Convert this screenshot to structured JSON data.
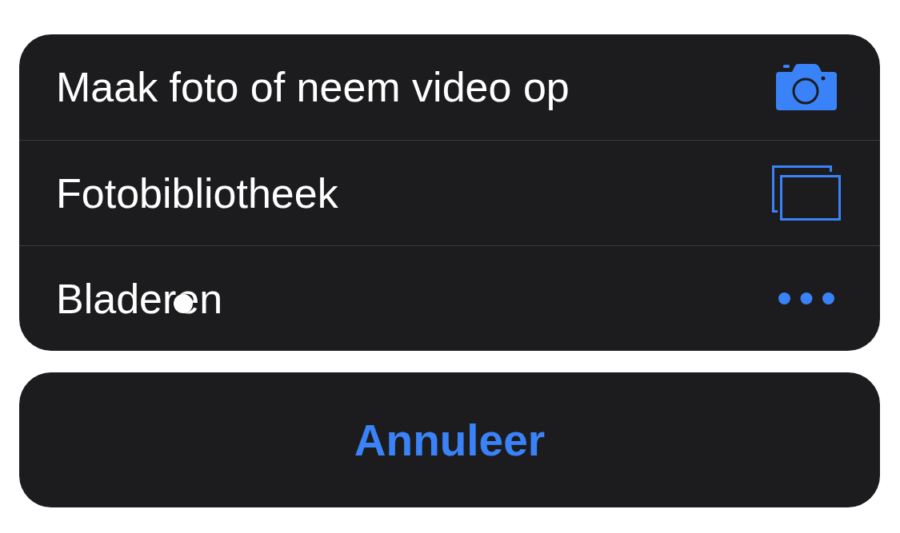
{
  "action_sheet": {
    "options": [
      {
        "label": "Maak foto of neem video op",
        "kind": "camera"
      },
      {
        "label": "Fotobibliotheek",
        "kind": "photos"
      },
      {
        "label": "Bladeren",
        "kind": "more"
      }
    ]
  },
  "cancel_button": {
    "label": "Annuleer"
  }
}
